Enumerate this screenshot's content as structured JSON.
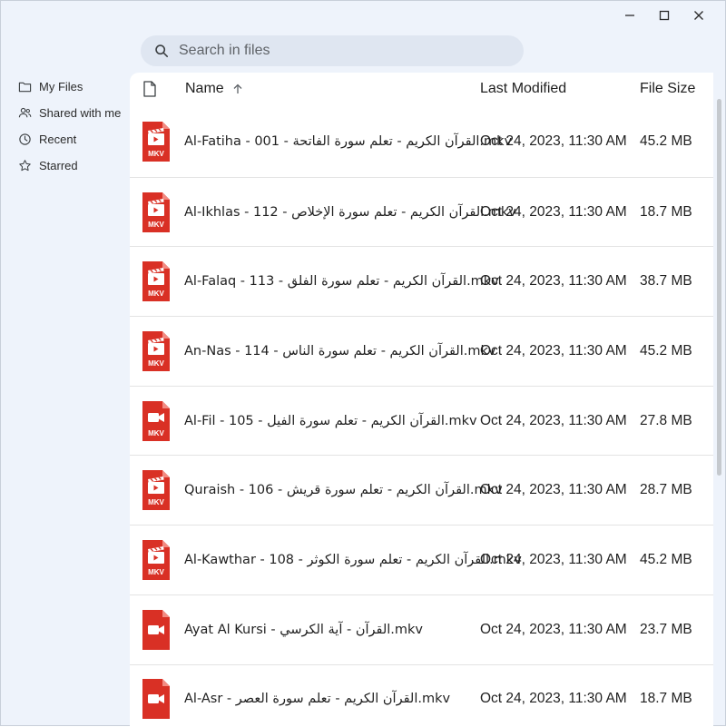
{
  "window": {
    "controls": {
      "minimize": "minimize-icon",
      "maximize": "maximize-icon",
      "close": "close-icon"
    }
  },
  "search": {
    "placeholder": "Search in files",
    "value": ""
  },
  "sidebar": {
    "items": [
      {
        "label": "My Files",
        "icon": "folder-icon"
      },
      {
        "label": "Shared with me",
        "icon": "people-icon"
      },
      {
        "label": "Recent",
        "icon": "clock-icon"
      },
      {
        "label": "Starred",
        "icon": "star-icon"
      }
    ]
  },
  "table": {
    "headers": {
      "name": "Name",
      "modified": "Last Modified",
      "size": "File Size"
    },
    "sort": {
      "column": "Name",
      "direction": "ascending"
    },
    "rows": [
      {
        "name": "Al-Fatiha - 001 - القرآن الكريم - تعلم سورة الفاتحة.mkv",
        "modified": "Oct 24, 2023, 11:30 AM",
        "size": "45.2 MB",
        "icon": "mkv-clapper"
      },
      {
        "name": "Al-Ikhlas - 112 - القرآن الكريم - تعلم سورة الإخلاص.mkv",
        "modified": "Oct 24, 2023, 11:30 AM",
        "size": "18.7 MB",
        "icon": "mkv-clapper"
      },
      {
        "name": "Al-Falaq - 113 - القرآن الكريم - تعلم سورة الفلق.mkv",
        "modified": "Oct 24, 2023, 11:30 AM",
        "size": "38.7 MB",
        "icon": "mkv-clapper"
      },
      {
        "name": "An-Nas - 114 - القرآن الكريم - تعلم سورة الناس.mkv",
        "modified": "Oct 24, 2023, 11:30 AM",
        "size": "45.2 MB",
        "icon": "mkv-clapper"
      },
      {
        "name": "Al-Fil - 105 - القرآن الكريم - تعلم سورة الفيل.mkv",
        "modified": "Oct 24, 2023, 11:30 AM",
        "size": "27.8 MB",
        "icon": "mkv-camera"
      },
      {
        "name": "Quraish - 106 - القرآن الكريم - تعلم سورة قريش.mkv",
        "modified": "Oct 24, 2023, 11:30 AM",
        "size": "28.7 MB",
        "icon": "mkv-clapper"
      },
      {
        "name": "Al-Kawthar - 108 - القرآن الكريم - تعلم سورة الكوثر.mkv",
        "modified": "Oct 24, 2023, 11:30 AM",
        "size": "45.2 MB",
        "icon": "mkv-clapper"
      },
      {
        "name": "Ayat Al Kursi - القرآن - آية الكرسي.mkv",
        "modified": "Oct 24, 2023, 11:30 AM",
        "size": "23.7 MB",
        "icon": "video-camera"
      },
      {
        "name": "Al-Asr - القرآن الكريم - تعلم سورة العصر.mkv",
        "modified": "Oct 24, 2023, 11:30 AM",
        "size": "18.7 MB",
        "icon": "video-camera"
      }
    ]
  },
  "colors": {
    "accent_file_icon": "#d93025",
    "window_bg": "#eef3fb",
    "search_bg": "#dfe6f1",
    "row_divider": "#e3e3e3"
  }
}
